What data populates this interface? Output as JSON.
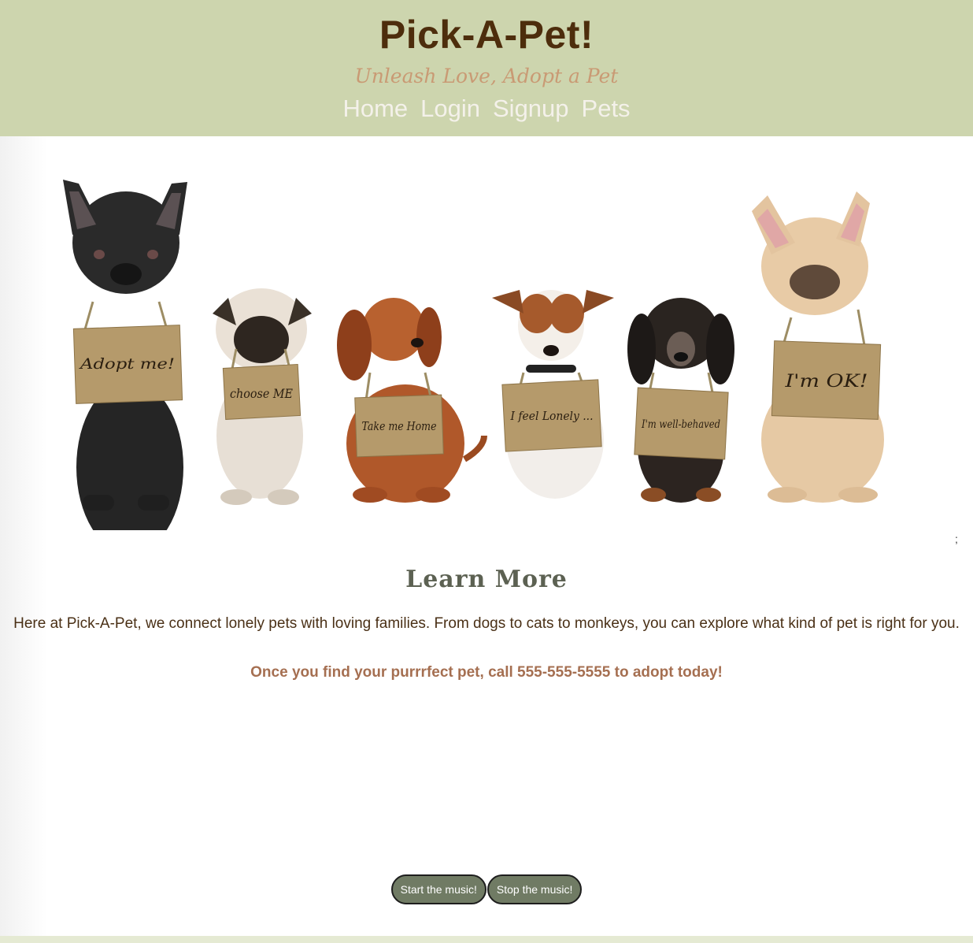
{
  "header": {
    "title": "Pick-A-Pet!",
    "tagline": "Unleash Love, Adopt a Pet",
    "nav": [
      {
        "label": "Home"
      },
      {
        "label": "Login"
      },
      {
        "label": "Signup"
      },
      {
        "label": "Pets"
      }
    ]
  },
  "hero": {
    "signs": [
      "Adopt me!",
      "choose ME",
      "Take me Home",
      "I feel Lonely ...",
      "I'm well-behaved",
      "I'm OK!"
    ]
  },
  "stray_text": ";",
  "main": {
    "heading": "Learn More",
    "about": "Here at Pick-A-Pet, we connect lonely pets with loving families. From dogs to cats to monkeys, you can explore what kind of pet is right for you.",
    "cta": "Once you find your purrrfect pet, call 555-555-5555 to adopt today!"
  },
  "music": {
    "start_label": "Start the music!",
    "stop_label": "Stop the music!"
  },
  "colors": {
    "header_bg": "#cdd5ae",
    "title": "#4d2d0c",
    "tagline": "#c99a74",
    "nav": "#f4f1ea",
    "heading": "#5c6152",
    "cta": "#a56f51",
    "button_bg": "#707b64",
    "footer_bg": "#e5ead3"
  }
}
